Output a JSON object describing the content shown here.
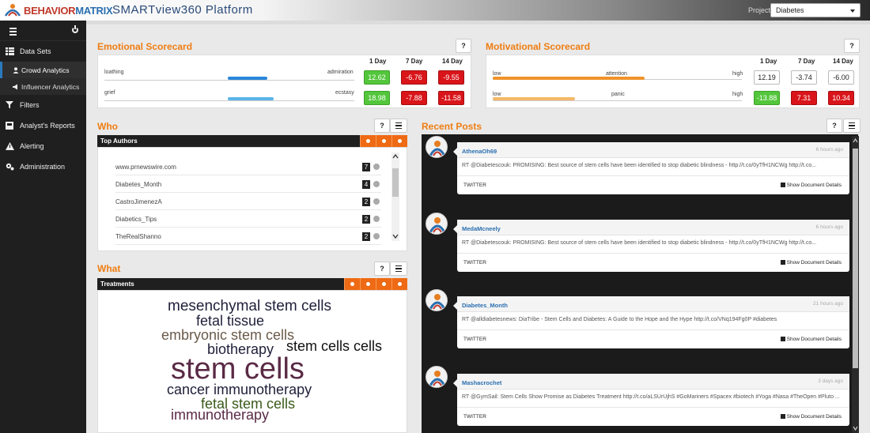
{
  "brand": {
    "logo_part1": "BEHAVIOR",
    "logo_part2": "MATRIX",
    "app_title": "SMARTview360 Platform"
  },
  "project": {
    "label": "Project:",
    "selected": "Diabetes"
  },
  "sidebar": {
    "items": [
      {
        "label": "Data Sets",
        "icon": "table-icon"
      },
      {
        "label": "Crowd Analytics",
        "icon": "user-icon",
        "sub": true,
        "active": true
      },
      {
        "label": "Influencer Analytics",
        "icon": "megaphone-icon",
        "sub": true
      },
      {
        "label": "Filters",
        "icon": "filter-icon"
      },
      {
        "label": "Analyst's Reports",
        "icon": "inbox-icon"
      },
      {
        "label": "Alerting",
        "icon": "warning-icon"
      },
      {
        "label": "Administration",
        "icon": "cogs-icon"
      }
    ]
  },
  "emotional": {
    "title": "Emotional Scorecard",
    "headers": [
      "1 Day",
      "7 Day",
      "14 Day"
    ],
    "rows": [
      {
        "left": "loathing",
        "right": "admiration",
        "fill": 0.25,
        "color": "#2a87d8",
        "values": [
          "12.62",
          "-6.76",
          "-9.55"
        ],
        "classes": [
          "pos",
          "neg",
          "neg"
        ]
      },
      {
        "left": "grief",
        "right": "ecstasy",
        "fill": 0.29,
        "color": "#5ab4e8",
        "values": [
          "18.98",
          "-7.88",
          "-11.58"
        ],
        "classes": [
          "pos",
          "neg",
          "neg"
        ]
      }
    ]
  },
  "motivational": {
    "title": "Motivational Scorecard",
    "headers": [
      "1 Day",
      "7 Day",
      "14 Day"
    ],
    "rows": [
      {
        "left": "low",
        "mid": "attention",
        "right": "high",
        "fill": 0.61,
        "color": "#f0932a",
        "values": [
          "12.19",
          "-3.74",
          "-6.00"
        ],
        "classes": [
          "neu",
          "neu",
          "neu"
        ]
      },
      {
        "left": "low",
        "mid": "panic",
        "right": "high",
        "fill": 0.33,
        "color": "#f5b86a",
        "values": [
          "-13.88",
          "7.31",
          "10.34"
        ],
        "classes": [
          "pos",
          "neg",
          "neg"
        ]
      }
    ]
  },
  "who": {
    "title": "Who",
    "header": "Top Authors",
    "authors": [
      {
        "name": "www.prnewswire.com",
        "count": "7"
      },
      {
        "name": "Diabetes_Month",
        "count": "4"
      },
      {
        "name": "CastroJimenezA",
        "count": "2"
      },
      {
        "name": "Diabetics_Tips",
        "count": "2"
      },
      {
        "name": "TheRealShanno",
        "count": "2"
      }
    ]
  },
  "what": {
    "title": "What",
    "header": "Treatments",
    "words": [
      {
        "text": "mesenchymal stem cells",
        "color": "#1f1f3a"
      },
      {
        "text": "fetal tissue",
        "color": "#1f1f3a"
      },
      {
        "text": "embryonic stem cells",
        "color": "#6b5a4a"
      },
      {
        "text": "biotherapy",
        "color": "#1f1f3a"
      },
      {
        "text": "stem cells cells",
        "color": "#111111"
      },
      {
        "text": "stem cells",
        "color": "#5a2a45"
      },
      {
        "text": "cancer immunotherapy",
        "color": "#1f1f3a"
      },
      {
        "text": "fetal stem cells",
        "color": "#3a5a1a"
      },
      {
        "text": "immunotherapy",
        "color": "#5a2a45"
      }
    ]
  },
  "posts": {
    "title": "Recent Posts",
    "items": [
      {
        "author": "AthenaOh69",
        "time": "6 hours ago",
        "text": "RT @Diabetescouk: PROMISING: Best source of stem cells have been identified to stop diabetic blindness - http://t.co/0yTfH1NCWg http://t.co...",
        "source": "TWITTER",
        "details": "Show Document Details"
      },
      {
        "author": "MedaMcneely",
        "time": "6 hours ago",
        "text": "RT @Diabetescouk: PROMISING: Best source of stem cells have been identified to stop diabetic blindness - http://t.co/0yTfH1NCWg http://t.co...",
        "source": "TWITTER",
        "details": "Show Document Details"
      },
      {
        "author": "Diabetes_Month",
        "time": "21 hours ago",
        "text": "RT @alldiabetesnews: DiaTribe - Stem Cells and Diabetes: A Guide to the Hope and the Hype http://t.co/VNq194Fg0P #diabetes",
        "source": "TWITTER",
        "details": "Show Document Details"
      },
      {
        "author": "Mashacrochet",
        "time": "3 days ago",
        "text": "RT @GymSail: Stem Cells Show Promise as Diabetes Treatment http://t.co/aLSUrUjhS #GoMariners #Spacex #biotech #Yoga #Nasa #TheOpen #Pluto ...",
        "source": "TWITTER",
        "details": "Show Document Details"
      }
    ]
  }
}
